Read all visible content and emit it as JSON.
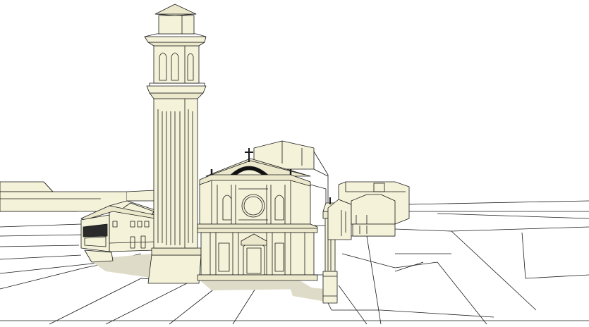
{
  "scene": {
    "colors": {
      "background": "#ffffff",
      "building_fill": "#f4f2d8",
      "building_shade": "#e6e3c2",
      "roof_fill": "#ebe8cc",
      "ground_fill": "#ffffff",
      "shadow": "#d9d7c4",
      "outline": "#1a1a1a",
      "dome": "#111111"
    }
  }
}
